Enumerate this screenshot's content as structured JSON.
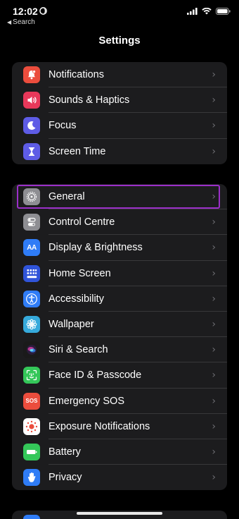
{
  "status_bar": {
    "time": "12:02",
    "back_link": "Search"
  },
  "nav": {
    "title": "Settings"
  },
  "groups": [
    {
      "items": [
        {
          "label": "Notifications",
          "icon": "bell-icon",
          "color": "#eb4d3d"
        },
        {
          "label": "Sounds & Haptics",
          "icon": "speaker-icon",
          "color": "#e8385a"
        },
        {
          "label": "Focus",
          "icon": "moon-icon",
          "color": "#5e5ce6"
        },
        {
          "label": "Screen Time",
          "icon": "hourglass-icon",
          "color": "#5e5ce6"
        }
      ]
    },
    {
      "items": [
        {
          "label": "General",
          "icon": "gear-icon",
          "color": "#8e8e93",
          "highlighted": true
        },
        {
          "label": "Control Centre",
          "icon": "toggles-icon",
          "color": "#8e8e93"
        },
        {
          "label": "Display & Brightness",
          "icon": "text-size-icon",
          "color": "#2f7cf6"
        },
        {
          "label": "Home Screen",
          "icon": "app-grid-icon",
          "color": "#3054d9"
        },
        {
          "label": "Accessibility",
          "icon": "accessibility-icon",
          "color": "#2f7cf6"
        },
        {
          "label": "Wallpaper",
          "icon": "flower-icon",
          "color": "#36aadc"
        },
        {
          "label": "Siri & Search",
          "icon": "siri-icon",
          "color": "#1a1a1a"
        },
        {
          "label": "Face ID & Passcode",
          "icon": "face-id-icon",
          "color": "#34c759"
        },
        {
          "label": "Emergency SOS",
          "icon": "sos-icon",
          "color": "#eb4d3d"
        },
        {
          "label": "Exposure Notifications",
          "icon": "exposure-icon",
          "color": "#ffffff"
        },
        {
          "label": "Battery",
          "icon": "battery-icon",
          "color": "#34c759"
        },
        {
          "label": "Privacy",
          "icon": "hand-icon",
          "color": "#2f7cf6"
        }
      ]
    }
  ],
  "sos_icon_text": "SOS",
  "display_icon_text": "AA"
}
